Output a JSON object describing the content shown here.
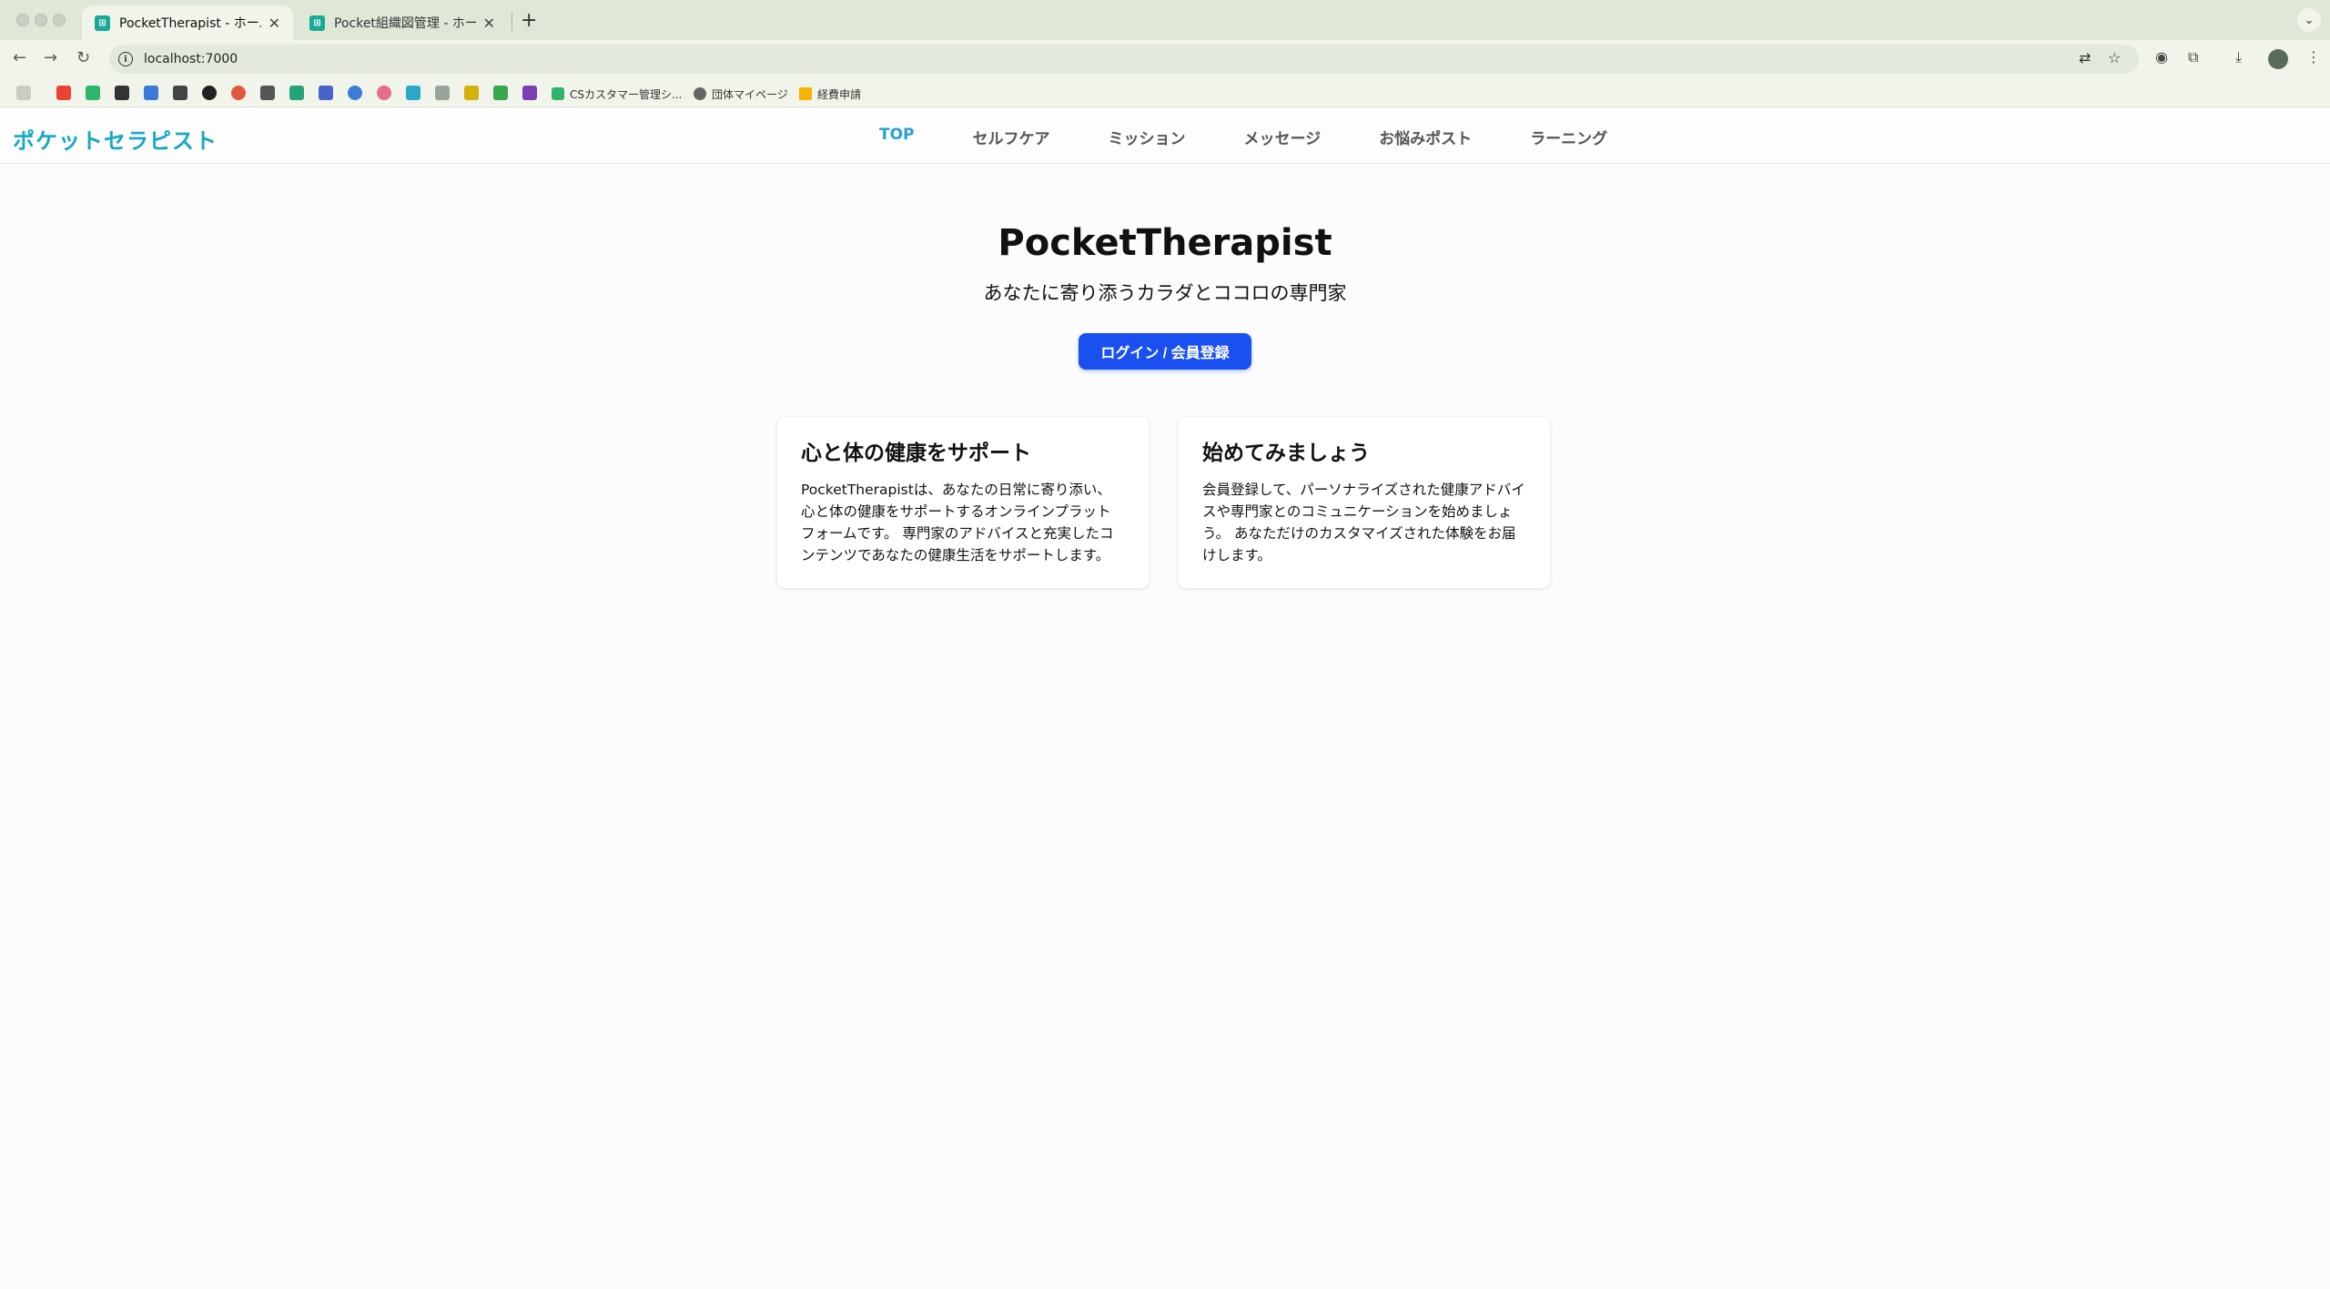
{
  "browser": {
    "tabs": [
      {
        "title": "PocketTherapist - ホーム",
        "active": true
      },
      {
        "title": "Pocket組織図管理 - ホーム",
        "active": false
      }
    ],
    "url": "localhost:7000",
    "bookmarks": [
      {
        "label": "CSカスタマー管理シ..."
      },
      {
        "label": "団体マイページ"
      },
      {
        "label": "経費申請"
      }
    ]
  },
  "app": {
    "logo": "ポケットセラピスト",
    "nav": [
      {
        "label": "TOP",
        "active": true
      },
      {
        "label": "セルフケア"
      },
      {
        "label": "ミッション"
      },
      {
        "label": "メッセージ"
      },
      {
        "label": "お悩みポスト"
      },
      {
        "label": "ラーニング"
      }
    ],
    "hero": {
      "title": "PocketTherapist",
      "subtitle": "あなたに寄り添うカラダとココロの専門家",
      "cta": "ログイン / 会員登録"
    },
    "cards": [
      {
        "title": "心と体の健康をサポート",
        "body": "PocketTherapistは、あなたの日常に寄り添い、心と体の健康をサポートするオンラインプラットフォームです。 専門家のアドバイスと充実したコンテンツであなたの健康生活をサポートします。"
      },
      {
        "title": "始めてみましょう",
        "body": "会員登録して、パーソナライズされた健康アドバイスや専門家とのコミュニケーションを始めましょう。 あなただけのカスタマイズされた体験をお届けします。"
      }
    ]
  },
  "colors": {
    "accent_nav": "#2a9fd6",
    "logo": "#18a8c4",
    "cta": "#1a4ff0"
  }
}
